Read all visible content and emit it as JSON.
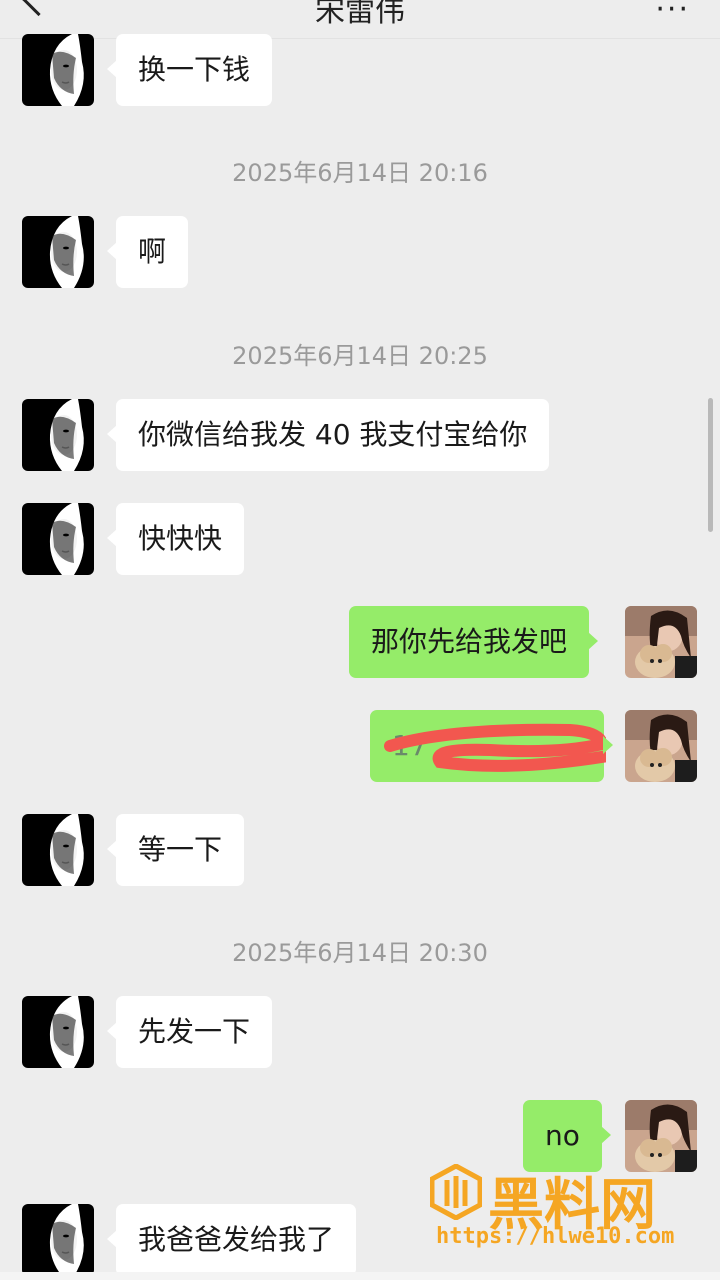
{
  "header": {
    "title": "宋雷伟",
    "back_icon": "chevron-left-icon",
    "more_icon": "ellipsis-icon"
  },
  "colors": {
    "background": "#ededed",
    "incoming_bubble": "#ffffff",
    "outgoing_bubble": "#95ec69",
    "timestamp": "#9a9a9a",
    "watermark": "#f5a623"
  },
  "messages": [
    {
      "type": "in",
      "text": "换一下钱"
    },
    {
      "type": "time",
      "text": "2025年6月14日 20:16"
    },
    {
      "type": "in",
      "text": "啊"
    },
    {
      "type": "time",
      "text": "2025年6月14日 20:25"
    },
    {
      "type": "in",
      "text": "你微信给我发 40 我支付宝给你"
    },
    {
      "type": "in",
      "text": "快快快"
    },
    {
      "type": "out",
      "text": "那你先给我发吧"
    },
    {
      "type": "out",
      "text": "17"
    },
    {
      "type": "in",
      "text": "等一下"
    },
    {
      "type": "time",
      "text": "2025年6月14日 20:30"
    },
    {
      "type": "in",
      "text": "先发一下"
    },
    {
      "type": "out",
      "text": "no"
    },
    {
      "type": "in",
      "text": "我爸爸发给我了"
    }
  ],
  "watermark": {
    "text": "黑料网",
    "url": "https://hlwe10.com"
  }
}
